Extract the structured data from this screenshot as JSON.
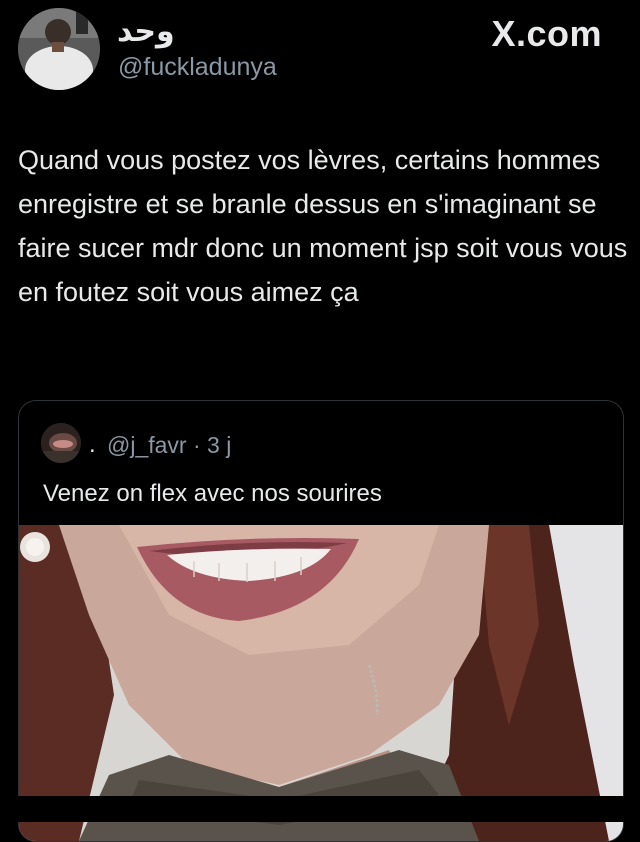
{
  "post": {
    "author_display_name": "وحد",
    "author_handle": "@fuckladunya",
    "site": "X.com",
    "text": "Quand vous postez vos lèvres, certains hommes enregistre et se branle dessus en s'imaginant se faire sucer mdr donc un moment jsp soit vous vous en foutez soit vous aimez ça"
  },
  "quoted_post": {
    "dot": ".",
    "meta": "@j_favr · 3 j",
    "text": "Venez on flex avec nos sourires"
  },
  "colors": {
    "background": "#000000",
    "primary_text": "#e7e9ea",
    "secondary_text": "#8b98a5",
    "border": "#2f3336"
  }
}
